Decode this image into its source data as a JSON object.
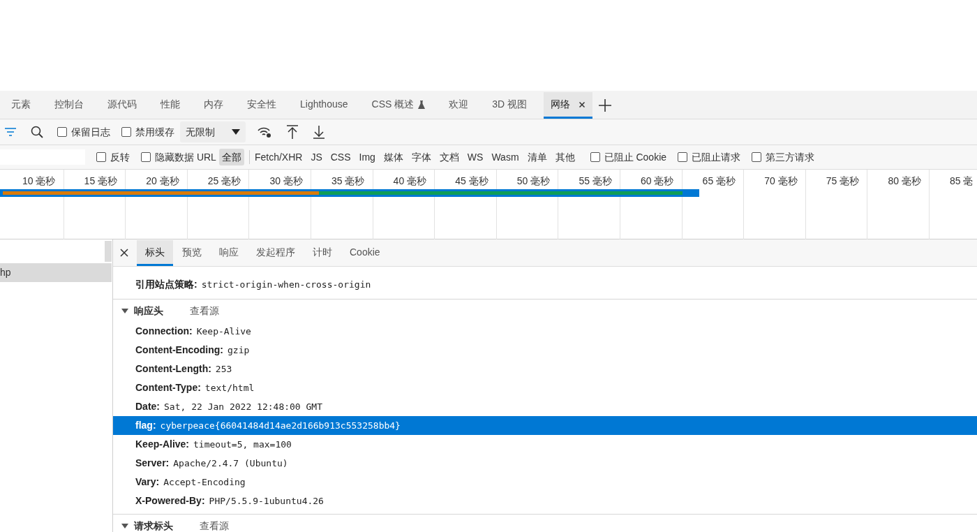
{
  "tabs": [
    {
      "label": "元素",
      "selected": false,
      "kind": "plain"
    },
    {
      "label": "控制台",
      "selected": false,
      "kind": "plain"
    },
    {
      "label": "源代码",
      "selected": false,
      "kind": "plain"
    },
    {
      "label": "性能",
      "selected": false,
      "kind": "plain"
    },
    {
      "label": "内存",
      "selected": false,
      "kind": "plain"
    },
    {
      "label": "安全性",
      "selected": false,
      "kind": "plain"
    },
    {
      "label": "Lighthouse",
      "selected": false,
      "kind": "plain"
    },
    {
      "label": "CSS 概述",
      "selected": false,
      "kind": "experimental"
    },
    {
      "label": "欢迎",
      "selected": false,
      "kind": "plain"
    },
    {
      "label": "3D 视图",
      "selected": false,
      "kind": "plain"
    },
    {
      "label": "网络",
      "selected": true,
      "kind": "closable"
    }
  ],
  "toolbar": {
    "checkboxes": [
      {
        "label": "保留日志",
        "checked": false
      },
      {
        "label": "禁用缓存",
        "checked": false
      }
    ],
    "throttling": "无限制"
  },
  "filter_bar": {
    "options": [
      {
        "label": "反转",
        "checked": false
      },
      {
        "label": "隐藏数据 URL",
        "checked": false
      }
    ],
    "types": [
      {
        "label": "全部",
        "selected": true
      },
      {
        "label": "Fetch/XHR",
        "selected": false
      },
      {
        "label": "JS",
        "selected": false
      },
      {
        "label": "CSS",
        "selected": false
      },
      {
        "label": "Img",
        "selected": false
      },
      {
        "label": "媒体",
        "selected": false
      },
      {
        "label": "字体",
        "selected": false
      },
      {
        "label": "文档",
        "selected": false
      },
      {
        "label": "WS",
        "selected": false
      },
      {
        "label": "Wasm",
        "selected": false
      },
      {
        "label": "清单",
        "selected": false
      },
      {
        "label": "其他",
        "selected": false
      }
    ],
    "blocking": [
      {
        "label": "已阻止 Cookie",
        "checked": false
      },
      {
        "label": "已阻止请求",
        "checked": false
      },
      {
        "label": "第三方请求",
        "checked": false
      }
    ]
  },
  "timeline": {
    "ticks": [
      "10 毫秒",
      "15 毫秒",
      "20 毫秒",
      "25 毫秒",
      "30 毫秒",
      "35 毫秒",
      "40 毫秒",
      "45 毫秒",
      "50 毫秒",
      "55 毫秒",
      "60 毫秒",
      "65 毫秒",
      "70 毫秒",
      "75 毫秒",
      "80 毫秒",
      "85 毫"
    ]
  },
  "requests": [
    {
      "name": "hp",
      "selected": true
    }
  ],
  "detail_tabs": [
    {
      "label": "标头",
      "selected": true
    },
    {
      "label": "预览",
      "selected": false
    },
    {
      "label": "响应",
      "selected": false
    },
    {
      "label": "发起程序",
      "selected": false
    },
    {
      "label": "计时",
      "selected": false
    },
    {
      "label": "Cookie",
      "selected": false
    }
  ],
  "general_rows": [
    {
      "name": "引用站点策略:",
      "value": "strict-origin-when-cross-origin"
    }
  ],
  "sections": [
    {
      "title": "响应头",
      "link": "查看源",
      "expanded": true,
      "headers": [
        {
          "name": "Connection:",
          "value": "Keep-Alive",
          "selected": false
        },
        {
          "name": "Content-Encoding:",
          "value": "gzip",
          "selected": false
        },
        {
          "name": "Content-Length:",
          "value": "253",
          "selected": false
        },
        {
          "name": "Content-Type:",
          "value": "text/html",
          "selected": false
        },
        {
          "name": "Date:",
          "value": "Sat, 22 Jan 2022 12:48:00 GMT",
          "selected": false
        },
        {
          "name": "flag:",
          "value": "cyberpeace{66041484d14ae2d166b913c553258bb4}",
          "selected": true
        },
        {
          "name": "Keep-Alive:",
          "value": "timeout=5, max=100",
          "selected": false
        },
        {
          "name": "Server:",
          "value": "Apache/2.4.7 (Ubuntu)",
          "selected": false
        },
        {
          "name": "Vary:",
          "value": "Accept-Encoding",
          "selected": false
        },
        {
          "name": "X-Powered-By:",
          "value": "PHP/5.5.9-1ubuntu4.26",
          "selected": false
        }
      ]
    },
    {
      "title": "请求标头",
      "link": "查看源",
      "expanded": true
    }
  ]
}
